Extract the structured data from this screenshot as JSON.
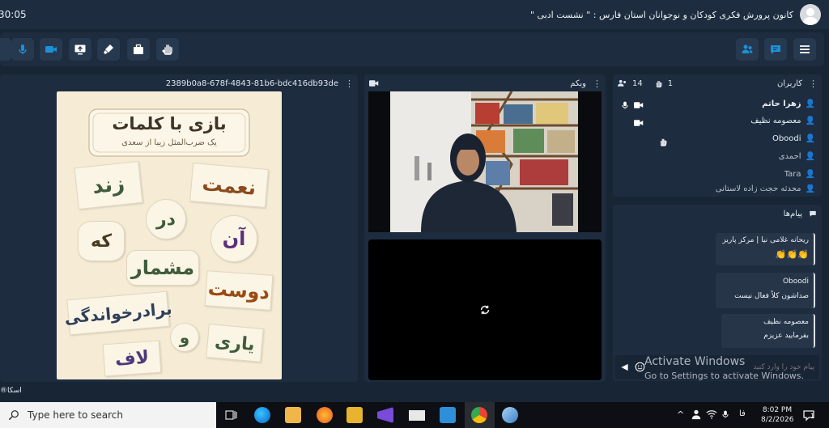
{
  "topbar": {
    "clock": "30:05",
    "title": "کانون پرورش فکری کودکان و نوجوانان استان فارس : \" نشست ادبی \""
  },
  "presentation": {
    "id": "2389b0a8-678f-4843-81b6-bdc416db93de",
    "slide": {
      "title": "بازی با کلمات",
      "subtitle": "یک ضرب‌المثل زیبا از سعدی",
      "words": [
        "زند",
        "نعمت",
        "در",
        "که",
        "آن",
        "مشمار",
        "دوست",
        "برادرخواندگی",
        "و",
        "یاری",
        "لاف"
      ]
    }
  },
  "webcam": {
    "label": "وبکم"
  },
  "users": {
    "label": "کاربران",
    "count": "14",
    "hands": "1",
    "list": [
      {
        "name": "زهرا حاتم",
        "bold": true,
        "mic": true,
        "cam": true,
        "icon_color": "#4f9be8"
      },
      {
        "name": "معصومه نظیف",
        "cam": true,
        "icon_color": "#4f9be8"
      },
      {
        "name": "Oboodi",
        "icon_color": "#e4c52b"
      },
      {
        "name": "احمدی",
        "icon_color": "#c8b54b",
        "dim": true
      },
      {
        "name": "Tara",
        "icon_color": "#c8b54b",
        "dim": true
      },
      {
        "name": "محدثه حجت زاده لاستانی",
        "icon_color": "#c8b54b",
        "dim": true
      }
    ]
  },
  "chat": {
    "label": "پیام‌ها",
    "messages": [
      {
        "name": "ریحانه غلامی نیا | مرکز پاریز",
        "text": "👏👏👏"
      },
      {
        "name": "Oboodi",
        "text": "صداشون کلاً فعال نیست"
      },
      {
        "name": "معصومه نظیف",
        "text": "بفرمایید عزیزم"
      }
    ],
    "placeholder": "پیام خود را وارد کنید"
  },
  "footer_label": "اسکا",
  "watermark": {
    "line1": "Activate Windows",
    "line2": "Go to Settings to activate Windows."
  },
  "taskbar": {
    "search_placeholder": "Type here to search",
    "lang": "فا",
    "time": "8:02 PM",
    "date": "8/2/2026",
    "notif_count": "1"
  },
  "colors": {
    "accent": "#1e90d8",
    "panel": "#1d2c3e",
    "bg": "#182535"
  }
}
